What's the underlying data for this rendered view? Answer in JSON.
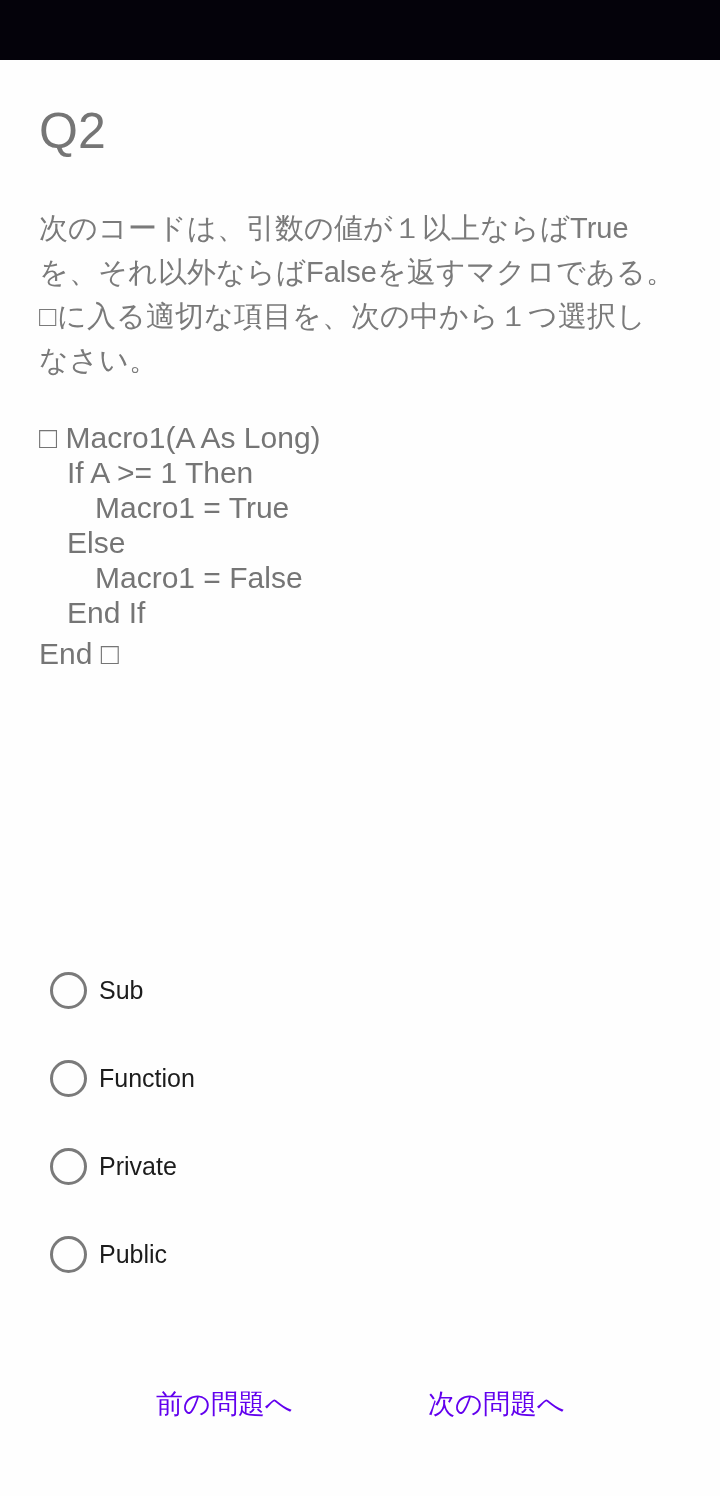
{
  "question": {
    "number": "Q2",
    "paragraphs": [
      "次のコードは、引数の値が１以上ならばTrueを、それ以外ならばFalseを返すマクロである。",
      "□に入る適切な項目を、次の中から１つ選択しなさい。"
    ]
  },
  "code": [
    {
      "text": "□ Macro1(A As Long)",
      "children": [
        {
          "text": "If A >= 1 Then",
          "children": [
            {
              "text": "Macro1 = True"
            }
          ]
        },
        {
          "text": "Else",
          "children": [
            {
              "text": "Macro1 = False"
            }
          ]
        },
        {
          "text": "End If"
        }
      ]
    },
    {
      "text": "End □"
    }
  ],
  "options": [
    {
      "label": "Sub",
      "selected": false
    },
    {
      "label": "Function",
      "selected": false
    },
    {
      "label": "Private",
      "selected": false
    },
    {
      "label": "Public",
      "selected": false
    }
  ],
  "navigation": [
    {
      "label": "前の問題へ"
    },
    {
      "label": "次の問題へ"
    }
  ]
}
